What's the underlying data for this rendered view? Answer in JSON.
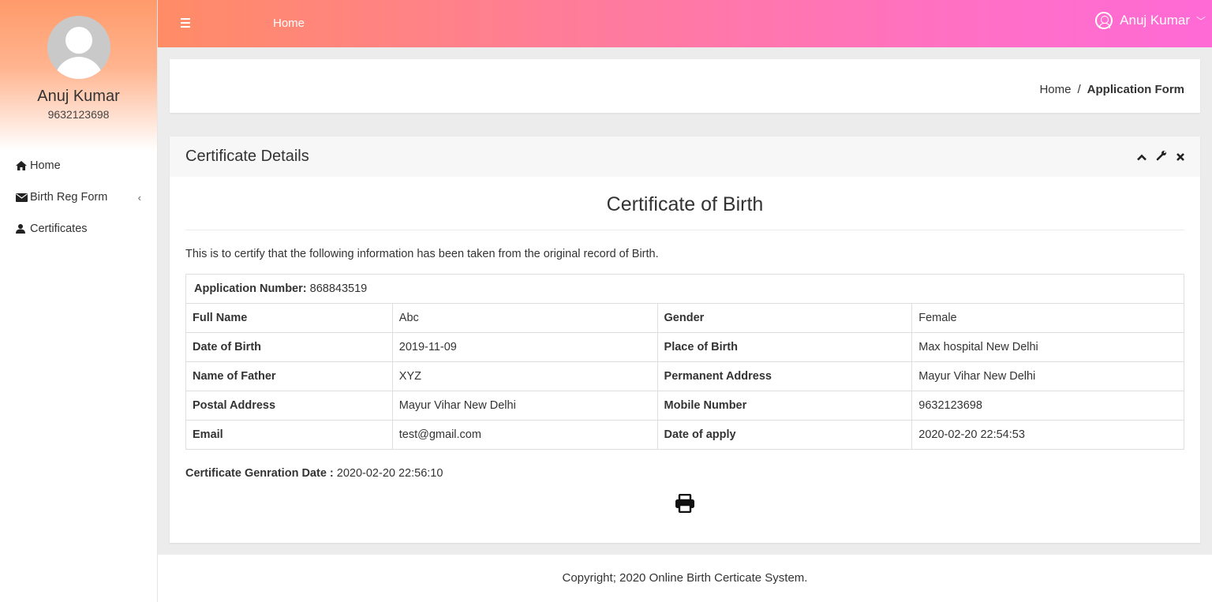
{
  "sidebar": {
    "user_name": "Anuj Kumar",
    "user_phone": "9632123698",
    "items": [
      {
        "label": "Home",
        "icon": "home-icon"
      },
      {
        "label": "Birth Reg Form",
        "icon": "envelope-icon",
        "has_submenu": true
      },
      {
        "label": "Certificates",
        "icon": "user-icon"
      }
    ]
  },
  "topbar": {
    "page": "Home",
    "user_name": "Anuj Kumar"
  },
  "breadcrumb": {
    "home": "Home",
    "separator": "/",
    "current": "Application Form"
  },
  "panel": {
    "title": "Certificate Details",
    "cert_title": "Certificate of Birth",
    "intro": "This is to certify that the following information has been taken from the original record of Birth.",
    "app_number_label": "Application Number:",
    "app_number": "868843519",
    "rows": [
      {
        "l1": "Full Name",
        "v1": "Abc",
        "l2": "Gender",
        "v2": "Female"
      },
      {
        "l1": "Date of Birth",
        "v1": "2019-11-09",
        "l2": "Place of Birth",
        "v2": "Max hospital New Delhi"
      },
      {
        "l1": "Name of Father",
        "v1": "XYZ",
        "l2": "Permanent Address",
        "v2": "Mayur Vihar New Delhi"
      },
      {
        "l1": "Postal Address",
        "v1": "Mayur Vihar New Delhi",
        "l2": "Mobile Number",
        "v2": "9632123698"
      },
      {
        "l1": "Email",
        "v1": "test@gmail.com",
        "l2": "Date of apply",
        "v2": "2020-02-20 22:54:53"
      }
    ],
    "gen_label": "Certificate Genration Date :",
    "gen_value": "2020-02-20 22:56:10"
  },
  "footer": {
    "text": "Copyright; 2020 Online Birth Certicate System."
  },
  "colors": {
    "topbar_start": "#ff8c66",
    "topbar_end": "#ff6ad5",
    "content_bg": "#ececec"
  }
}
